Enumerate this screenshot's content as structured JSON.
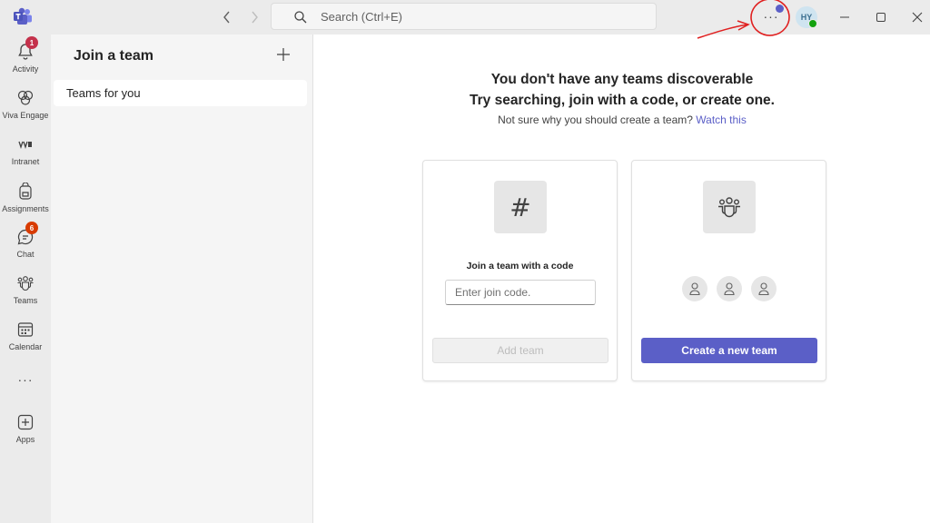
{
  "titlebar": {
    "search_placeholder": "Search (Ctrl+E)",
    "more_label": "···",
    "avatar_initials": "HY"
  },
  "rail": {
    "items": [
      {
        "label": "Activity",
        "icon": "bell-icon",
        "badge": "1"
      },
      {
        "label": "Viva Engage",
        "icon": "viva-engage-icon"
      },
      {
        "label": "Intranet",
        "icon": "intranet-icon"
      },
      {
        "label": "Assignments",
        "icon": "backpack-icon"
      },
      {
        "label": "Chat",
        "icon": "chat-icon",
        "badge": "6"
      },
      {
        "label": "Teams",
        "icon": "teams-icon"
      },
      {
        "label": "Calendar",
        "icon": "calendar-icon"
      },
      {
        "label": "Apps",
        "icon": "apps-icon"
      }
    ],
    "more_label": "···"
  },
  "panel": {
    "title": "Join a team",
    "items": [
      {
        "label": "Teams for you"
      }
    ]
  },
  "main": {
    "heading_line1": "You don't have any teams discoverable",
    "heading_line2": "Try searching, join with a code, or create one.",
    "sub_text": "Not sure why you should create a team?",
    "sub_link": "Watch this",
    "join_card": {
      "icon_glyph": "#",
      "title": "Join a team with a code",
      "input_placeholder": "Enter join code.",
      "button_label": "Add team"
    },
    "create_card": {
      "button_label": "Create a new team"
    }
  },
  "colors": {
    "accent": "#5b5fc7",
    "rail_bg": "#ebebeb",
    "panel_bg": "#f5f5f5",
    "badge_red": "#c4314b",
    "presence_green": "#13a10e",
    "annotation_red": "#e02020"
  }
}
